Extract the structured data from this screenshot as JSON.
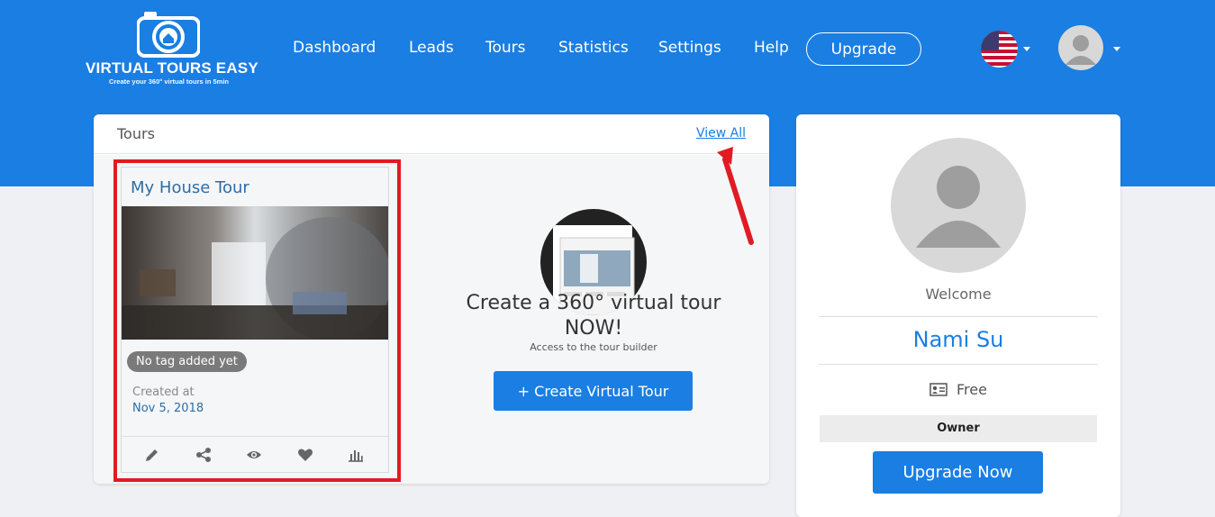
{
  "brand": {
    "title": "VIRTUAL TOURS EASY",
    "tagline": "Create your 360° virtual tours in 5min"
  },
  "nav": {
    "links": [
      "Dashboard",
      "Leads",
      "Tours",
      "Statistics",
      "Settings",
      "Help"
    ],
    "upgrade_label": "Upgrade",
    "language_icon": "us-flag-icon",
    "avatar_icon": "user-avatar-icon"
  },
  "tours_panel": {
    "title": "Tours",
    "view_all": "View All",
    "tour": {
      "name": "My House Tour",
      "tag": "No tag added yet",
      "created_label": "Created at",
      "created_date": "Nov 5, 2018",
      "actions": [
        "pencil-icon",
        "share-icon",
        "eye-icon",
        "heart-icon",
        "bar-chart-icon"
      ]
    },
    "promo": {
      "title": "Create a 360° virtual tour NOW!",
      "subtitle": "Access to the tour builder",
      "button": "+ Create Virtual Tour"
    }
  },
  "profile": {
    "welcome": "Welcome",
    "name": "Nami Su",
    "plan": "Free",
    "role": "Owner",
    "upgrade_button": "Upgrade Now"
  },
  "colors": {
    "primary": "#1a7ee3",
    "link": "#2e6da4",
    "highlight": "#e01b24"
  }
}
